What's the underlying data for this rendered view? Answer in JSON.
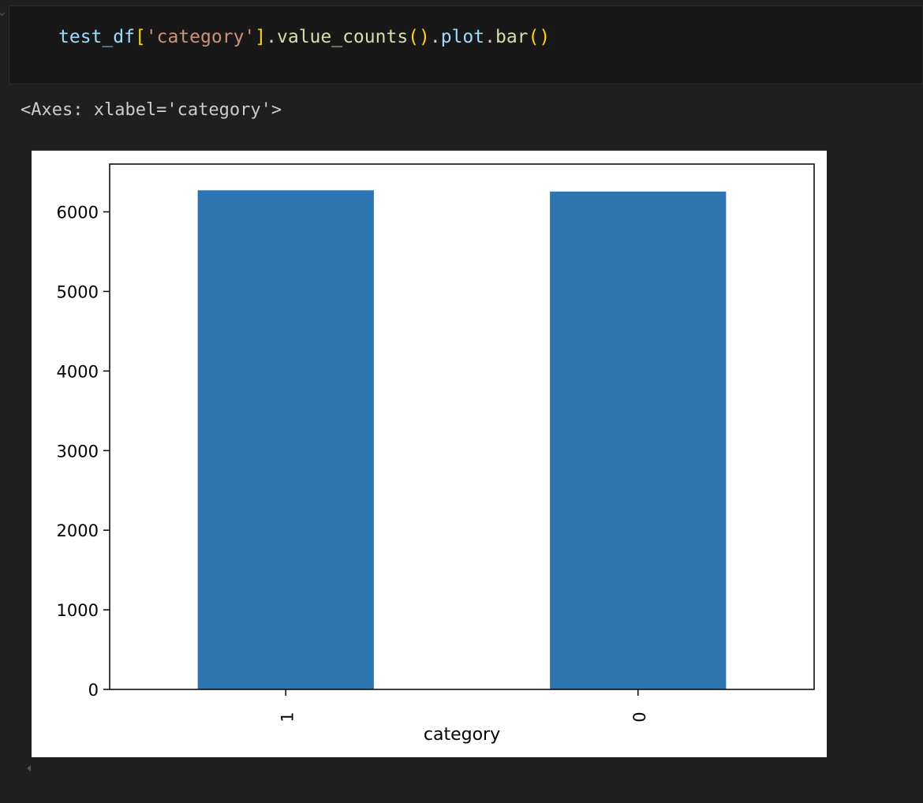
{
  "code_cell": {
    "tokens": [
      {
        "text": "test_df",
        "kind": "var"
      },
      {
        "text": "[",
        "kind": "bracket"
      },
      {
        "text": "'category'",
        "kind": "str"
      },
      {
        "text": "]",
        "kind": "bracket"
      },
      {
        "text": ".",
        "kind": "plain"
      },
      {
        "text": "value_counts",
        "kind": "fn"
      },
      {
        "text": "()",
        "kind": "bracket"
      },
      {
        "text": ".",
        "kind": "plain"
      },
      {
        "text": "plot",
        "kind": "var"
      },
      {
        "text": ".",
        "kind": "plain"
      },
      {
        "text": "bar",
        "kind": "fn"
      },
      {
        "text": "()",
        "kind": "bracket"
      }
    ]
  },
  "output": {
    "repr_text": "<Axes: xlabel='category'>"
  },
  "chart_data": {
    "type": "bar",
    "categories": [
      "1",
      "0"
    ],
    "values": [
      6270,
      6255
    ],
    "title": "",
    "xlabel": "category",
    "ylabel": "",
    "ylim": [
      0,
      6600
    ],
    "yticks": [
      0,
      1000,
      2000,
      3000,
      4000,
      5000,
      6000
    ],
    "ytick_labels": [
      "0",
      "1000",
      "2000",
      "3000",
      "4000",
      "5000",
      "6000"
    ],
    "bar_color": "#2c75b0",
    "xtick_rotation": "vertical",
    "grid": false,
    "legend": false
  }
}
